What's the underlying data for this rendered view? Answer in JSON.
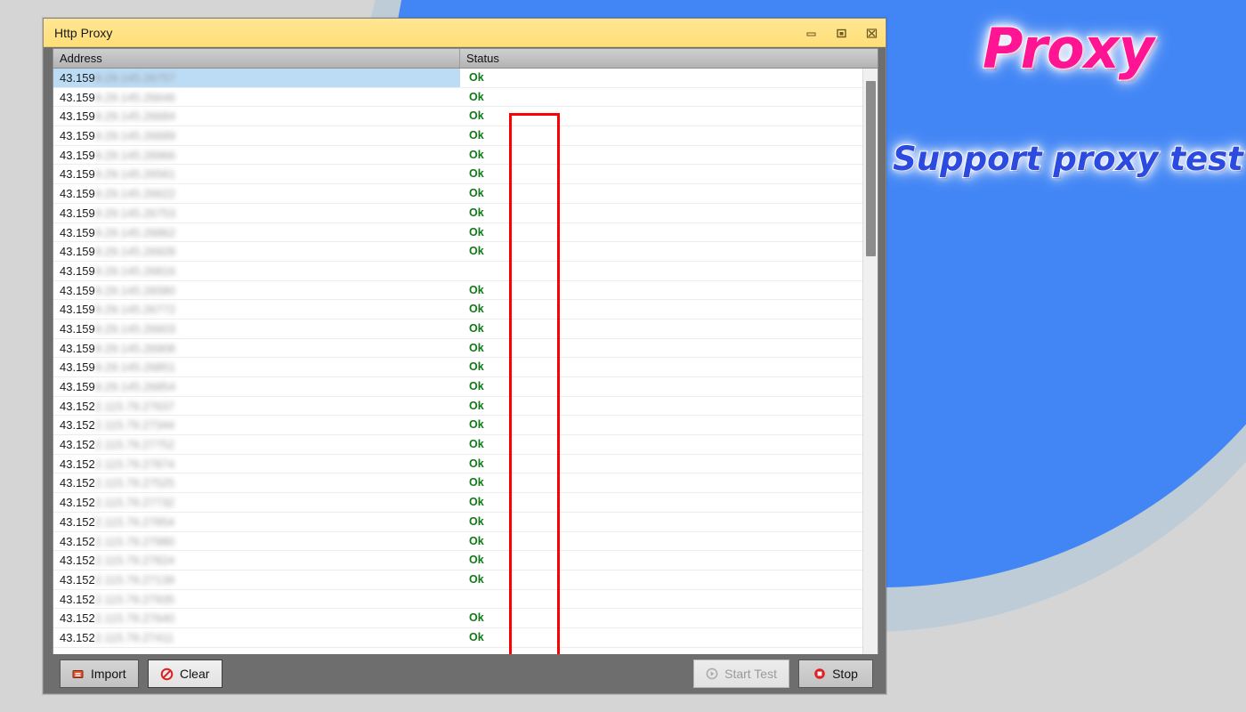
{
  "background": {
    "base_color": "#d5d5d5",
    "ring_color": "#bdccd6",
    "circle_color": "#4286f5"
  },
  "promo": {
    "title": "Proxy",
    "title_color": "#ff1493",
    "subtitle": "Support proxy test",
    "subtitle_color": "#2a4ae0"
  },
  "window": {
    "title": "Http Proxy",
    "titlebar_color": "#ffdf78",
    "controls": [
      {
        "name": "minimize-button",
        "label": "—"
      },
      {
        "name": "maximize-button",
        "label": "□"
      },
      {
        "name": "close-button",
        "label": "✕"
      }
    ]
  },
  "list": {
    "columns": [
      "Address",
      "Status"
    ],
    "selected_row_index": 0,
    "selection_color": "#bcdcf5",
    "status_ok_color": "#0f7a16",
    "rows": [
      {
        "address_visible": "43.159",
        "address_redacted": "9.29.145.26757",
        "status": "Ok"
      },
      {
        "address_visible": "43.159",
        "address_redacted": "9.29.145.26646",
        "status": "Ok"
      },
      {
        "address_visible": "43.159",
        "address_redacted": "9.29.145.26684",
        "status": "Ok"
      },
      {
        "address_visible": "43.159",
        "address_redacted": "9.29.145.26689",
        "status": "Ok"
      },
      {
        "address_visible": "43.159",
        "address_redacted": "9.29.145.26966",
        "status": "Ok"
      },
      {
        "address_visible": "43.159",
        "address_redacted": "9.29.145.26561",
        "status": "Ok"
      },
      {
        "address_visible": "43.159",
        "address_redacted": "9.29.145.26622",
        "status": "Ok"
      },
      {
        "address_visible": "43.159",
        "address_redacted": "9.29.145.26753",
        "status": "Ok"
      },
      {
        "address_visible": "43.159",
        "address_redacted": "9.29.145.26862",
        "status": "Ok"
      },
      {
        "address_visible": "43.159",
        "address_redacted": "9.29.145.26928",
        "status": "Ok"
      },
      {
        "address_visible": "43.159",
        "address_redacted": "9.29.145.26816",
        "status": ""
      },
      {
        "address_visible": "43.159",
        "address_redacted": "9.29.145.26580",
        "status": "Ok"
      },
      {
        "address_visible": "43.159",
        "address_redacted": "9.29.145.26772",
        "status": "Ok"
      },
      {
        "address_visible": "43.159",
        "address_redacted": "9.29.145.26603",
        "status": "Ok"
      },
      {
        "address_visible": "43.159",
        "address_redacted": "9.29.145.26908",
        "status": "Ok"
      },
      {
        "address_visible": "43.159",
        "address_redacted": "9.29.145.26851",
        "status": "Ok"
      },
      {
        "address_visible": "43.159",
        "address_redacted": "9.29.145.26854",
        "status": "Ok"
      },
      {
        "address_visible": "43.152",
        "address_redacted": "2.115.79.27637",
        "status": "Ok"
      },
      {
        "address_visible": "43.152",
        "address_redacted": "2.115.79.27344",
        "status": "Ok"
      },
      {
        "address_visible": "43.152",
        "address_redacted": "2.115.79.27752",
        "status": "Ok"
      },
      {
        "address_visible": "43.152",
        "address_redacted": "2.115.79.27874",
        "status": "Ok"
      },
      {
        "address_visible": "43.152",
        "address_redacted": "2.115.79.27525",
        "status": "Ok"
      },
      {
        "address_visible": "43.152",
        "address_redacted": "2.115.79.27732",
        "status": "Ok"
      },
      {
        "address_visible": "43.152",
        "address_redacted": "2.115.79.27854",
        "status": "Ok"
      },
      {
        "address_visible": "43.152",
        "address_redacted": "2.115.79.27980",
        "status": "Ok"
      },
      {
        "address_visible": "43.152",
        "address_redacted": "2.115.79.27824",
        "status": "Ok"
      },
      {
        "address_visible": "43.152",
        "address_redacted": "2.115.79.27139",
        "status": "Ok"
      },
      {
        "address_visible": "43.152",
        "address_redacted": "2.115.79.27935",
        "status": ""
      },
      {
        "address_visible": "43.152",
        "address_redacted": "2.115.79.27640",
        "status": "Ok"
      },
      {
        "address_visible": "43.152",
        "address_redacted": "2.115.79.27411",
        "status": "Ok"
      }
    ]
  },
  "annotation": {
    "shape": "rectangle",
    "color": "#ff0000",
    "target_column": "Status"
  },
  "footer": {
    "import_label": "Import",
    "clear_label": "Clear",
    "start_test_label": "Start Test",
    "start_test_enabled": false,
    "stop_label": "Stop",
    "stop_enabled": true
  }
}
